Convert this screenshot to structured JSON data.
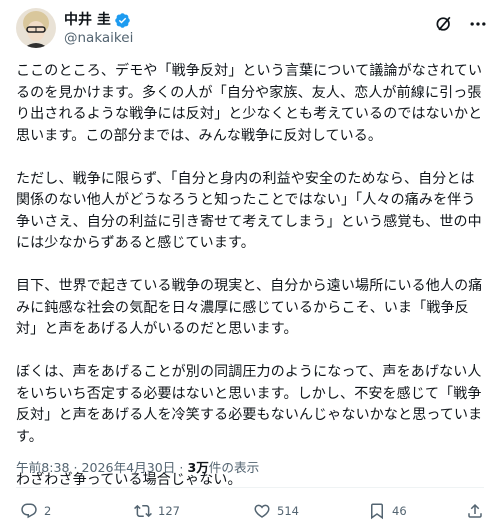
{
  "author": {
    "name": "中井 圭",
    "handle": "@nakaikei"
  },
  "icons": {
    "verified": "verified-badge-icon",
    "grok": "grok-icon",
    "more": "more-dots-icon",
    "reply": "reply-icon",
    "repost": "repost-icon",
    "like": "heart-icon",
    "bookmark": "bookmark-icon",
    "share": "share-icon"
  },
  "colors": {
    "verified": "#1d9bf0",
    "text": "#0f1419",
    "secondary": "#536471"
  },
  "body": {
    "paragraphs": [
      "ここのところ、デモや「戦争反対」という言葉について議論がなされているのを見かけます。多くの人が「自分や家族、友人、恋人が前線に引っ張り出されるような戦争には反対」と少なくとも考えているのではないかと思います。この部分までは、みんな戦争に反対している。",
      "ただし、戦争に限らず、「自分と身内の利益や安全のためなら、自分とは関係のない他人がどうなろうと知ったことではない」「人々の痛みを伴う争いさえ、自分の利益に引き寄せて考えてしまう」という感覚も、世の中には少なからずあると感じています。",
      "目下、世界で起きている戦争の現実と、自分から遠い場所にいる他人の痛みに鈍感な社会の気配を日々濃厚に感じているからこそ、いま「戦争反対」と声をあげる人がいるのだと思います。",
      "ぼくは、声をあげることが別の同調圧力のようになって、声をあげない人をいちいち否定する必要はないと思います。しかし、不安を感じて「戦争反対」と声をあげる人を冷笑する必要もないんじゃないかなと思っています。",
      "わざわざ争っている場合じゃない。"
    ]
  },
  "meta": {
    "time": "午前8:38",
    "separator1": "·",
    "date": "2026年4月30日",
    "separator2": "·",
    "views": "3万",
    "views_label": "件の表示"
  },
  "actions": {
    "replies": "2",
    "reposts": "127",
    "likes": "514",
    "bookmarks": "46"
  }
}
